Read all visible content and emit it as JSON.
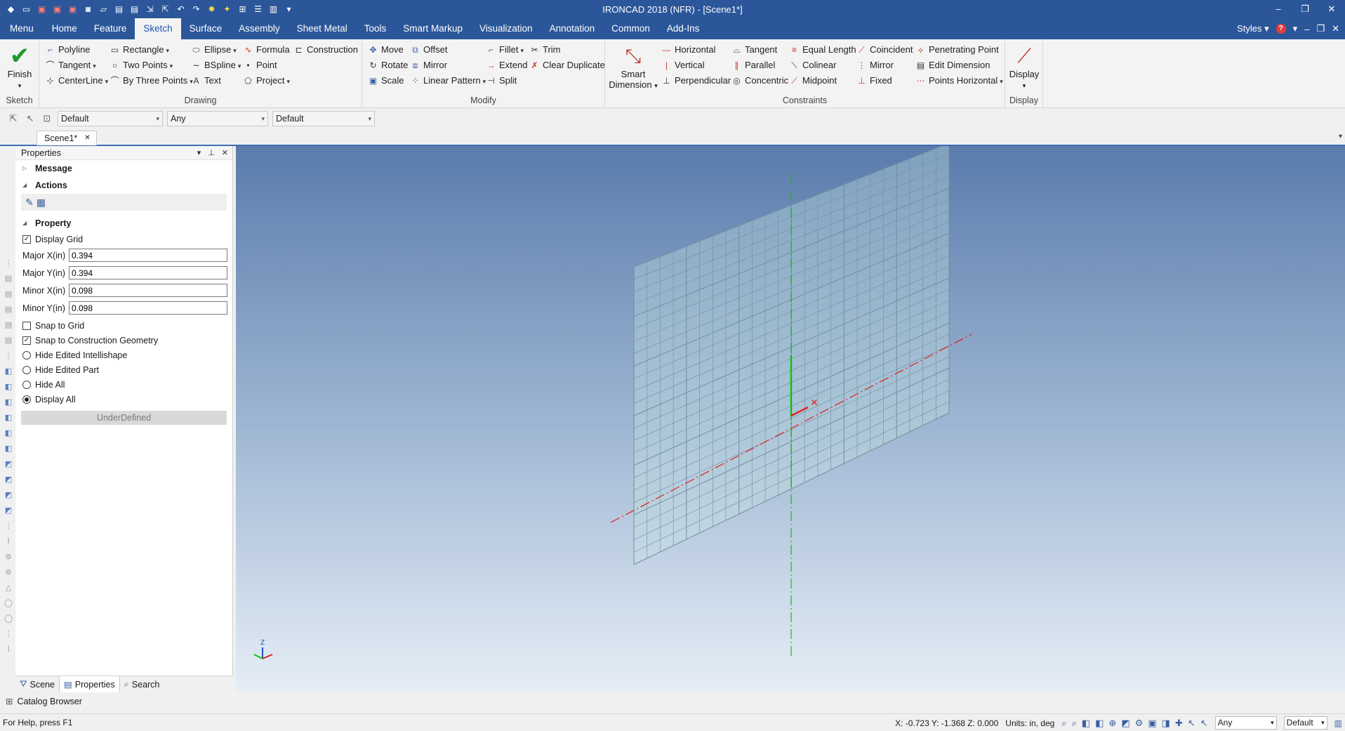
{
  "titlebar": {
    "title": "IRONCAD 2018 (NFR) - [Scene1*]",
    "quick_access_icons": [
      "app-icon",
      "new-icon",
      "open-icon",
      "delete-icon",
      "print-icon",
      "camera-icon",
      "folder-icon",
      "save-icon",
      "save-as-icon",
      "export-icon",
      "share-icon",
      "undo-icon",
      "redo-icon",
      "settings-icon",
      "bulb-icon",
      "grid-icon",
      "layout-icon",
      "panels-icon",
      "customize-icon"
    ],
    "controls": [
      "–",
      "❐",
      "✕"
    ]
  },
  "tabs": {
    "items": [
      "Menu",
      "Home",
      "Feature",
      "Sketch",
      "Surface",
      "Assembly",
      "Sheet Metal",
      "Tools",
      "Smart Markup",
      "Visualization",
      "Annotation",
      "Common",
      "Add-Ins"
    ],
    "active": "Sketch",
    "styles_label": "Styles"
  },
  "ribbon": {
    "sketch_group": {
      "label": "Sketch",
      "finish": "Finish"
    },
    "drawing_group": {
      "label": "Drawing",
      "polyline": "Polyline",
      "rectangle": "Rectangle",
      "ellipse": "Ellipse",
      "formula": "Formula",
      "construction": "Construction",
      "tangent": "Tangent",
      "two_points": "Two Points",
      "bspline": "BSpline",
      "point": "Point",
      "centerline": "CenterLine",
      "by_three_points": "By Three Points",
      "text": "Text",
      "project": "Project"
    },
    "modify_group": {
      "label": "Modify",
      "move": "Move",
      "offset": "Offset",
      "fillet": "Fillet",
      "trim": "Trim",
      "rotate": "Rotate",
      "mirror": "Mirror",
      "extend": "Extend",
      "clear_duplicate": "Clear Duplicate",
      "scale": "Scale",
      "linear_pattern": "Linear Pattern",
      "split": "Split"
    },
    "constraints_group": {
      "label": "Constraints",
      "smart_dimension_1": "Smart",
      "smart_dimension_2": "Dimension",
      "horizontal": "Horizontal",
      "vertical": "Vertical",
      "perpendicular": "Perpendicular",
      "tangent": "Tangent",
      "parallel": "Parallel",
      "concentric": "Concentric",
      "equal_length": "Equal Length",
      "colinear": "Colinear",
      "midpoint": "Midpoint",
      "coincident": "Coincident",
      "mirror": "Mirror",
      "fixed": "Fixed",
      "penetrating_point": "Penetrating Point",
      "edit_dimension": "Edit Dimension",
      "points_horizontal": "Points Horizontal"
    },
    "display_group": {
      "label": "Display",
      "display": "Display"
    }
  },
  "sketchbar": {
    "combo1": "Default",
    "combo2": "Any",
    "combo3": "Default"
  },
  "document": {
    "tab": "Scene1*",
    "close": "✕"
  },
  "properties": {
    "title": "Properties",
    "message": "Message",
    "actions": "Actions",
    "property": "Property",
    "display_grid": {
      "label": "Display Grid",
      "checked": true
    },
    "major_x": {
      "label": "Major X(in)",
      "value": "0.394"
    },
    "major_y": {
      "label": "Major Y(in)",
      "value": "0.394"
    },
    "minor_x": {
      "label": "Minor X(in)",
      "value": "0.098"
    },
    "minor_y": {
      "label": "Minor Y(in)",
      "value": "0.098"
    },
    "snap_to_grid": {
      "label": "Snap to Grid",
      "checked": false
    },
    "snap_to_construction": {
      "label": "Snap to Construction Geometry",
      "checked": true
    },
    "hide_edited_intellishape": "Hide Edited Intellishape",
    "hide_edited_part": "Hide Edited Part",
    "hide_all": "Hide All",
    "display_all": "Display All",
    "display_mode": "Display All",
    "status": "UnderDefined",
    "footer_tabs": [
      "Scene",
      "Properties",
      "Search"
    ],
    "active_footer_tab": "Properties"
  },
  "viewport": {
    "grid_color": "#6f8fa0",
    "x_axis_color": "#e02020",
    "y_axis_color": "#10c010",
    "triad_label": "Z"
  },
  "catalog": {
    "label": "Catalog Browser"
  },
  "statusbar": {
    "help": "For Help, press F1",
    "coords": "X: -0.723 Y: -1.368 Z: 0.000",
    "units": "Units: in, deg",
    "combo1": "Any",
    "combo2": "Default"
  }
}
